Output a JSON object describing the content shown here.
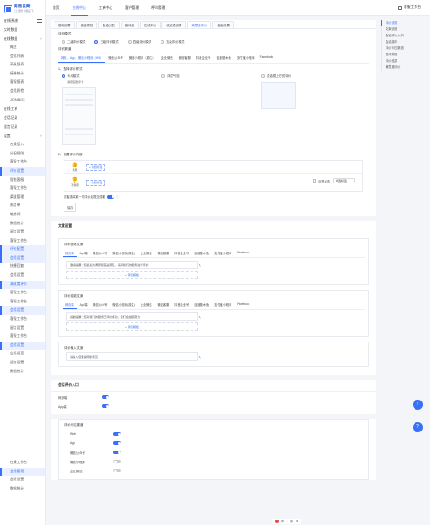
{
  "brand": {
    "name": "简易云商",
    "tagline": "云上服务 智能起飞",
    "accent": "#3a6ff7"
  },
  "sidebar": {
    "system_label": "在线系统",
    "items": [
      {
        "label": "实时数据",
        "kind": "item"
      },
      {
        "label": "在线数据",
        "kind": "group"
      },
      {
        "label": "概览",
        "kind": "sub"
      },
      {
        "label": "会话列表",
        "kind": "sub"
      },
      {
        "label": "高级报表",
        "kind": "sub"
      },
      {
        "label": "接待统计",
        "kind": "sub"
      },
      {
        "label": "客服报表",
        "kind": "sub"
      },
      {
        "label": "会话质检",
        "kind": "sub"
      },
      {
        "label": "JOINBOX",
        "kind": "sub"
      },
      {
        "label": "在线工单",
        "kind": "item"
      },
      {
        "label": "会话记录",
        "kind": "item"
      },
      {
        "label": "留言记录",
        "kind": "item"
      },
      {
        "label": "设置",
        "kind": "group"
      },
      {
        "label": "在线接入",
        "kind": "sub"
      },
      {
        "label": "分配规则",
        "kind": "sub"
      },
      {
        "label": "客服工作台",
        "kind": "sub"
      },
      {
        "label": "评价设置",
        "kind": "sub",
        "active": true
      },
      {
        "label": "智能客服",
        "kind": "sub"
      },
      {
        "label": "客服工作台",
        "kind": "sub"
      },
      {
        "label": "渠道管理",
        "kind": "sub"
      },
      {
        "label": "黑名单",
        "kind": "sub"
      },
      {
        "label": "敏感词",
        "kind": "sub"
      },
      {
        "label": "数据统计",
        "kind": "sub"
      },
      {
        "label": "留言设置",
        "kind": "sub"
      },
      {
        "label": "客服工作台",
        "kind": "sub"
      },
      {
        "label": "评价配置",
        "kind": "sub",
        "active": true
      },
      {
        "label": "会话设置",
        "kind": "sub",
        "active": true
      },
      {
        "label": "快捷回复",
        "kind": "sub"
      },
      {
        "label": "会话设置",
        "kind": "sub"
      },
      {
        "label": "满意度评价",
        "kind": "sub",
        "active": true
      },
      {
        "label": "客服工作台",
        "kind": "sub"
      },
      {
        "label": "客服工作台",
        "kind": "sub"
      },
      {
        "label": "会话设置",
        "kind": "sub",
        "active": true
      },
      {
        "label": "客服工作台",
        "kind": "sub"
      },
      {
        "label": "留言设置",
        "kind": "sub"
      },
      {
        "label": "客服工作台",
        "kind": "sub"
      },
      {
        "label": "会话设置",
        "kind": "sub",
        "active": true
      },
      {
        "label": "会话设置",
        "kind": "sub"
      },
      {
        "label": "留言设置",
        "kind": "sub"
      },
      {
        "label": "数据统计",
        "kind": "sub"
      }
    ],
    "bottom_items": [
      {
        "label": "在线工作台",
        "active": false
      },
      {
        "label": "会话管理",
        "active": true
      },
      {
        "label": "会话设置",
        "active": false
      },
      {
        "label": "数据统计",
        "active": false
      }
    ]
  },
  "topbar": {
    "tabs": [
      "首页",
      "在线中心",
      "工单中心",
      "客户管理",
      "呼叫管理"
    ],
    "active_tab": 1,
    "workspace_label": "客服工作台"
  },
  "page_tabs": {
    "tabs": [
      "基础设置",
      "会话规则",
      "会话分配",
      "接待组",
      "在线评价",
      "欢迎语设置",
      "满意度评价",
      "会话设置"
    ],
    "active": 6
  },
  "eval_mode": {
    "label": "评价模式",
    "options": [
      "二级评价模式",
      "三级评价模式",
      "四级评价模式",
      "五级评价模式"
    ],
    "selected": 1
  },
  "channels_label": "评价渠道",
  "channels": [
    "网页、App、微信小程序（H5）",
    "微信公众号",
    "微信小程序（原生）",
    "企业微信",
    "微信客服",
    "抖音企业号",
    "百度基木鱼",
    "支付宝小程序",
    "Facebook"
  ],
  "style_section": {
    "title": "1、选择评价样式",
    "options": [
      {
        "label": "卡片模式",
        "sub": "满意度邀评卡"
      },
      {
        "label": "浮层气泡"
      },
      {
        "label": "会话框上方的评价"
      }
    ],
    "selected": 0
  },
  "rate_section": {
    "title": "2、设置评价内容",
    "rows": [
      {
        "face": "满意",
        "tag_btn": "+ 添加标签"
      },
      {
        "face": "不满意",
        "tag_btn": "+ 添加标签",
        "check_label": "标签必选",
        "select_value": "单选标签"
      }
    ],
    "toggle_label": "访客选择某一项评价后提交感谢",
    "toggle_on": true,
    "save_button": "保存"
  },
  "msg_section": {
    "title": "文案设置",
    "blocks": [
      {
        "title": "评价邀请文案",
        "tabs": [
          "网页端",
          "App端",
          "微信公众号",
          "微信小程序(原生)",
          "企业微信",
          "微信客服",
          "抖音企业号",
          "百度基木鱼",
          "支付宝小程序",
          "Facebook"
        ],
        "active": 0,
        "line": "邀请提醒：您最后的满意程度是意见，请对我们的服务进行评价",
        "add_label": "+ 添加模板"
      },
      {
        "title": "评价感谢文案",
        "tabs": [
          "网页端",
          "App端",
          "微信公众号",
          "微信小程序(原生)",
          "企业微信",
          "微信客服",
          "抖音企业号",
          "百度基木鱼",
          "支付宝小程序",
          "Facebook"
        ],
        "active": 0,
        "line": "感谢提醒：您对我们的服务已评价成功，我们会继续努力",
        "add_label": "+ 添加模板"
      },
      {
        "title": "评价输入文案",
        "line": "请输入您要说明的意见"
      }
    ]
  },
  "entry_section": {
    "title": "会话评价入口",
    "rows": [
      {
        "label": "网页端",
        "on": true
      },
      {
        "label": "App端",
        "on": true
      }
    ]
  },
  "visible_section": {
    "title": "评价可见渠道",
    "rows": [
      {
        "label": "Web",
        "on": true
      },
      {
        "label": "App",
        "on": true
      },
      {
        "label": "微信公众号",
        "on": true
      },
      {
        "label": "微信小程序",
        "on": false
      },
      {
        "label": "企业微信",
        "on": false
      }
    ]
  },
  "anchor_nav": {
    "items": [
      "评价设置",
      "文案设置",
      "会话评价入口",
      "会话操作",
      "评价可见渠道",
      "邀评规则",
      "评价结果",
      "满意度评价"
    ],
    "active": 0
  },
  "fab": {
    "top_icon": "↑",
    "help_icon": "?"
  },
  "bottom_bar": [
    "中",
    "·",
    "简",
    "⚙"
  ]
}
